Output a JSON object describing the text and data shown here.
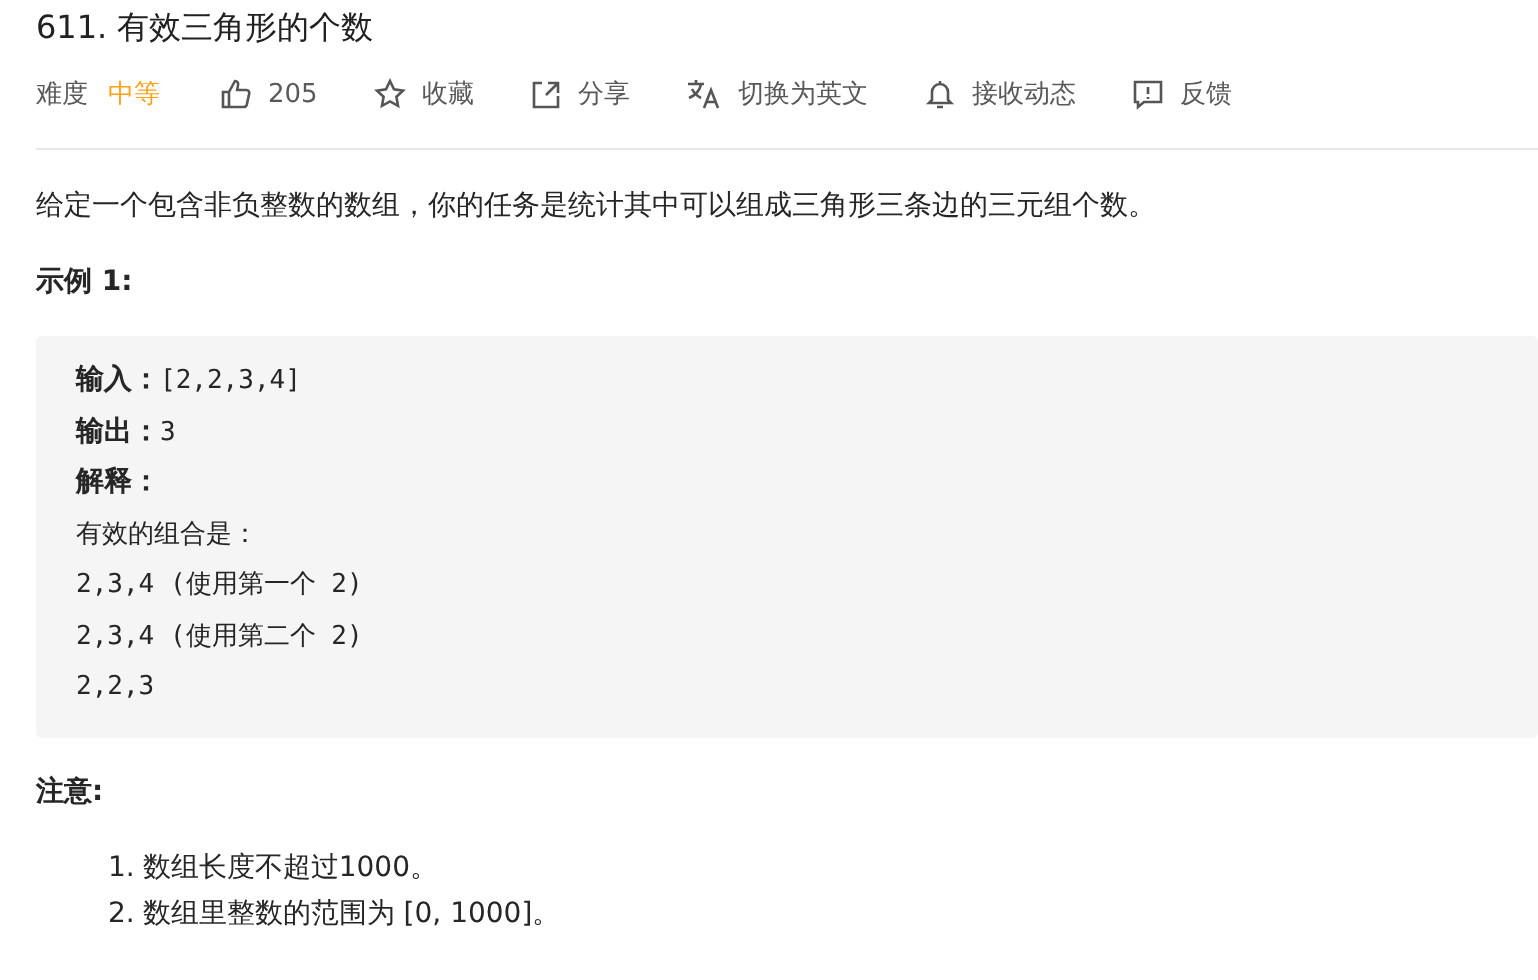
{
  "title": "611. 有效三角形的个数",
  "toolbar": {
    "difficulty_label": "难度",
    "difficulty": "中等",
    "actions": [
      {
        "kind": "like",
        "label": "205"
      },
      {
        "kind": "star",
        "label": "收藏"
      },
      {
        "kind": "share",
        "label": "分享"
      },
      {
        "kind": "translate",
        "label": "切换为英文"
      },
      {
        "kind": "bell",
        "label": "接收动态"
      },
      {
        "kind": "feedback",
        "label": "反馈"
      }
    ]
  },
  "description": "给定一个包含非负整数的数组，你的任务是统计其中可以组成三角形三条边的三元组个数。",
  "example": {
    "heading": "示例 1:",
    "lines": [
      "**输入：**[2,2,3,4]",
      "**输出：**3",
      "**解释：**",
      "有效的组合是：",
      "2,3,4 (使用第一个 2)",
      "2,3,4 (使用第二个 2)",
      "2,2,3"
    ]
  },
  "note": {
    "heading": "注意:",
    "items": [
      {
        "number": "1.",
        "text": "数组长度不超过1000。"
      },
      {
        "number": "2.",
        "text": "数组里整数的范围为 [0, 1000]。"
      }
    ]
  }
}
